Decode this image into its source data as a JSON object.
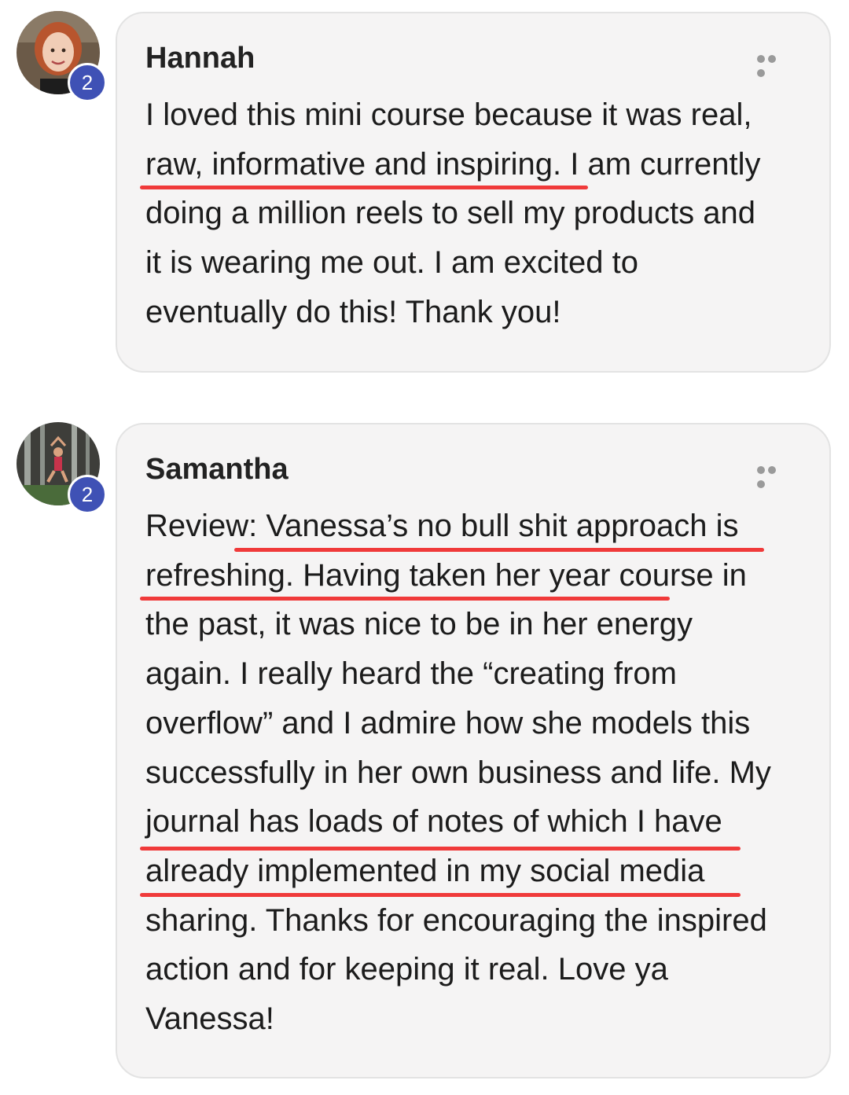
{
  "comments": [
    {
      "author": "Hannah",
      "badge": "2",
      "text": "I loved this mini course because it was real,\nraw, informative and inspiring. I am currently\ndoing a million reels to sell my products and\nit is wearing me out. I am excited to\neventually do this! Thank you!"
    },
    {
      "author": "Samantha",
      "badge": "2",
      "text": "Review: Vanessa’s no bull shit approach is\nrefreshing. Having taken her year course in\nthe past, it was nice to be in her energy\nagain. I really heard the “creating from\noverflow” and I admire how she models this\nsuccessfully in her own business and life. My\njournal has loads of notes of which I have\nalready implemented in my social media\nsharing. Thanks for encouraging the inspired\naction and for keeping it real. Love ya\nVanessa!"
    }
  ],
  "colors": {
    "badge": "#3f51b5",
    "underline": "#f03a3a",
    "card_background": "#f5f4f4"
  },
  "icons": [
    "more-options-icon",
    "avatar"
  ]
}
